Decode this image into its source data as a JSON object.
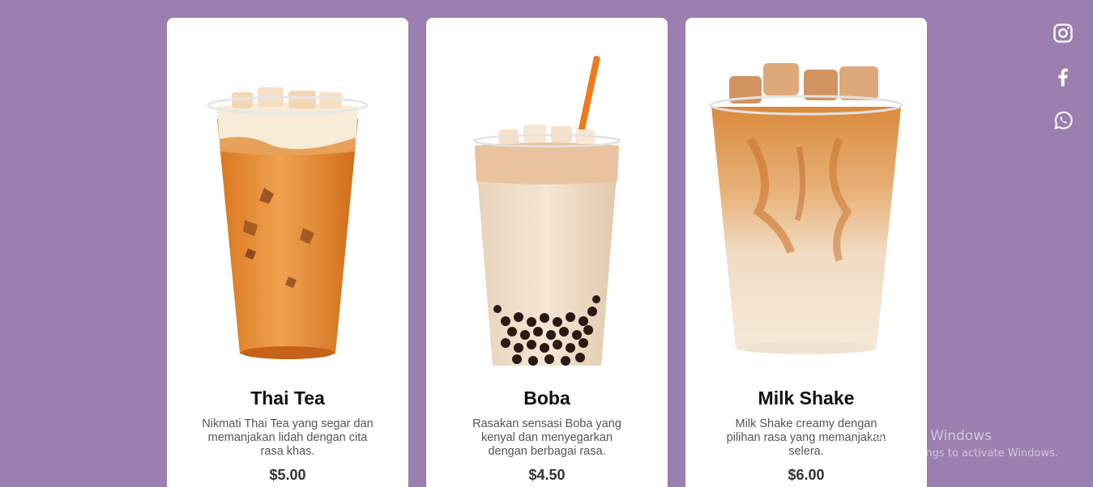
{
  "menu": {
    "items": [
      {
        "name": "Thai Tea",
        "description": "Nikmati Thai Tea yang segar dan memanjakan lidah dengan cita rasa khas.",
        "price": "$5.00",
        "image": "thai-tea-cup"
      },
      {
        "name": "Boba",
        "description": "Rasakan sensasi Boba yang kenyal dan menyegarkan dengan berbagai rasa.",
        "price": "$4.50",
        "image": "boba-cup"
      },
      {
        "name": "Milk Shake",
        "description": "Milk Shake creamy dengan pilihan rasa yang memanjakan selera.",
        "price": "$6.00",
        "image": "milkshake-cup"
      }
    ]
  },
  "social": {
    "icons": [
      "instagram-icon",
      "facebook-icon",
      "whatsapp-icon"
    ]
  },
  "watermark": {
    "line1": "Activate Windows",
    "line2": "Go to Settings to activate Windows."
  },
  "colors": {
    "background": "#9a7fb0",
    "card": "#ffffff",
    "thai_tea": "#e08a2e",
    "boba_milk": "#ecd9c3",
    "pearl": "#2b1a14"
  }
}
